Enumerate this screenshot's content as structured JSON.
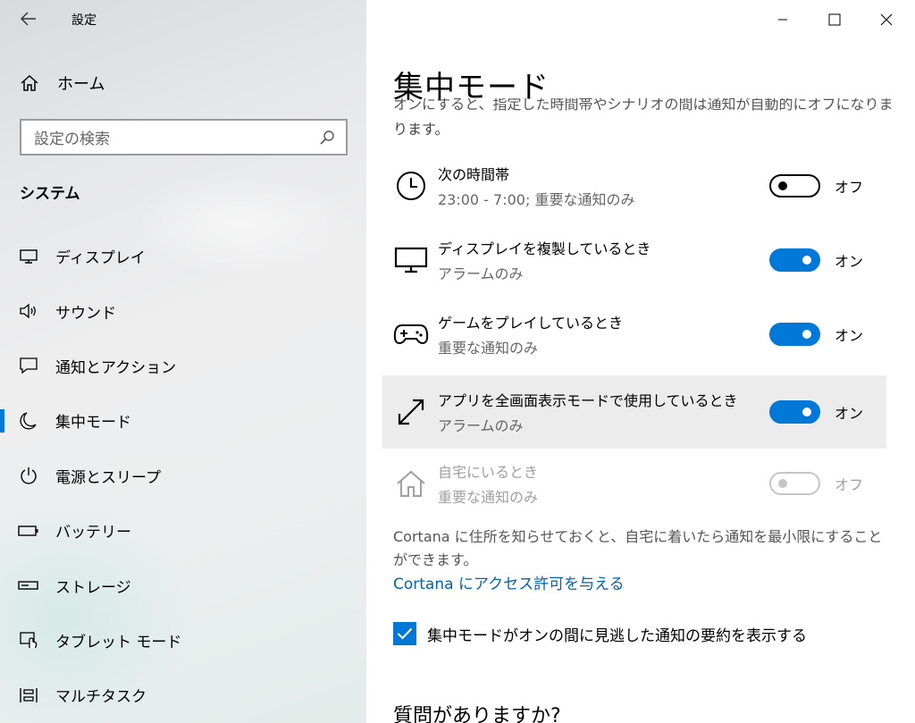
{
  "app": {
    "title": "設定",
    "back_icon": "back-arrow-icon"
  },
  "window_controls": {
    "minimize_icon": "minimize-icon",
    "maximize_icon": "maximize-icon",
    "close_icon": "close-icon"
  },
  "sidebar": {
    "home_label": "ホーム",
    "search_placeholder": "設定の検索",
    "section_title": "システム",
    "items": [
      {
        "label": "ディスプレイ",
        "icon": "display-icon",
        "active": false
      },
      {
        "label": "サウンド",
        "icon": "speaker-icon",
        "active": false
      },
      {
        "label": "通知とアクション",
        "icon": "message-icon",
        "active": false
      },
      {
        "label": "集中モード",
        "icon": "moon-icon",
        "active": true
      },
      {
        "label": "電源とスリープ",
        "icon": "power-icon",
        "active": false
      },
      {
        "label": "バッテリー",
        "icon": "battery-icon",
        "active": false
      },
      {
        "label": "ストレージ",
        "icon": "storage-icon",
        "active": false
      },
      {
        "label": "タブレット モード",
        "icon": "tablet-mode-icon",
        "active": false
      },
      {
        "label": "マルチタスク",
        "icon": "multitask-icon",
        "active": false
      }
    ]
  },
  "main": {
    "title": "集中モード",
    "clipped_desc": "オンにすると、指定した時間帯やシナリオの間は通知が自動的にオフになります。",
    "desc_tail": "ります。",
    "rules": [
      {
        "title": "次の時間帯",
        "subtitle": "23:00 - 7:00; 重要な通知のみ",
        "state": "オフ",
        "on": false,
        "icon": "clock-icon"
      },
      {
        "title": "ディスプレイを複製しているとき",
        "subtitle": "アラームのみ",
        "state": "オン",
        "on": true,
        "icon": "monitor-icon"
      },
      {
        "title": "ゲームをプレイしているとき",
        "subtitle": "重要な通知のみ",
        "state": "オン",
        "on": true,
        "icon": "gamepad-icon"
      },
      {
        "title": "アプリを全画面表示モードで使用しているとき",
        "subtitle": "アラームのみ",
        "state": "オン",
        "on": true,
        "icon": "fullscreen-arrow-icon"
      },
      {
        "title": "自宅にいるとき",
        "subtitle": "重要な通知のみ",
        "state": "オフ",
        "on": false,
        "icon": "house-icon",
        "disabled": true
      }
    ],
    "cortana_note": "Cortana に住所を知らせておくと、自宅に着いたら通知を最小限にすることができます。",
    "cortana_link": "Cortana にアクセス許可を与える",
    "summary_checkbox": {
      "label": "集中モードがオンの間に見逃した通知の要約を表示する",
      "checked": true
    },
    "question": "質問がありますか?"
  },
  "colors": {
    "accent": "#0078d7",
    "link": "#0063b1",
    "hover_row": "#ececec"
  }
}
